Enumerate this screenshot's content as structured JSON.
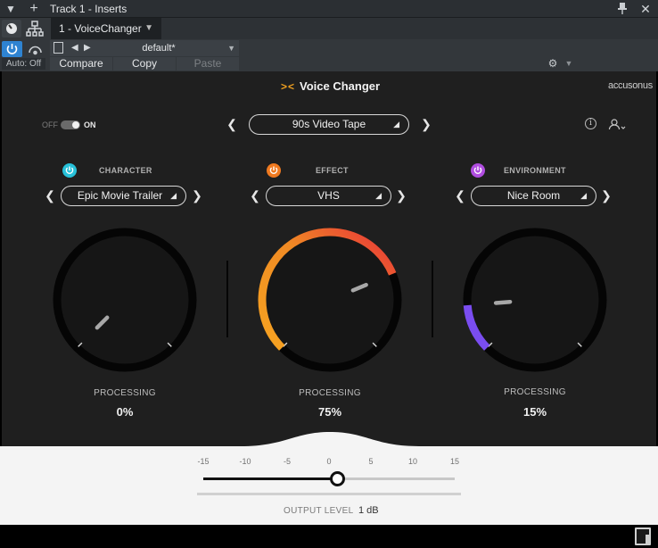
{
  "host": {
    "title": "Track 1 - Inserts",
    "insert_name": "1 - VoiceChanger",
    "preset": "default*",
    "auto": "Auto: Off",
    "compare": "Compare",
    "copy": "Copy",
    "paste": "Paste"
  },
  "plugin": {
    "title": "Voice Changer",
    "company": "accusonus",
    "toggle": {
      "off": "OFF",
      "on": "ON",
      "state": "on"
    },
    "main_preset": "90s Video Tape",
    "sections": [
      {
        "label": "CHARACTER",
        "preset": "Epic Movie Trailer",
        "processing_label": "PROCESSING",
        "value": "0%",
        "amount": 0,
        "power_color": "#27c1d9",
        "arc_color": "none"
      },
      {
        "label": "EFFECT",
        "preset": "VHS",
        "processing_label": "PROCESSING",
        "value": "75%",
        "amount": 0.75,
        "power_color": "#f07a20",
        "arc_color": "orange-red-gradient"
      },
      {
        "label": "ENVIRONMENT",
        "preset": "Nice Room",
        "processing_label": "PROCESSING",
        "value": "15%",
        "amount": 0.15,
        "power_color": "#b04de0",
        "arc_color": "#7a4df0"
      }
    ]
  },
  "output": {
    "scale": [
      "-15",
      "-10",
      "-5",
      "0",
      "5",
      "10",
      "15"
    ],
    "label": "OUTPUT LEVEL",
    "value_text": "1 dB",
    "value_db": 1,
    "range": [
      -15,
      15
    ]
  },
  "colors": {
    "accent_blue": "#2e83d1",
    "panel_bg": "#1f1f1f",
    "effect_arc_start": "#f6a321",
    "effect_arc_end": "#e8323a",
    "environment_arc": "#7a4df0"
  }
}
